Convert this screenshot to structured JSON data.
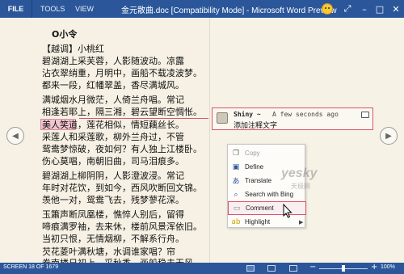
{
  "titlebar": {
    "file_tab": "FILE",
    "tabs": [
      "TOOLS",
      "VIEW"
    ],
    "window_title": "金元散曲.doc [Compatibility Mode] - Microsoft Word Preview"
  },
  "document": {
    "title": "O小令",
    "lines": [
      "【越调】小桃红",
      "碧湖湖上采芙蓉，人影随波动。凉露",
      "沾衣翠绡重，月明中，画船不载凌波梦。",
      "都来一段，红幡翠盖，香尽满城风。",
      "满城烟水月微茫，人倚兰舟唱。常记",
      "相逢若耶上，隔三湘，碧云望断空惆怅。",
      "美人笑道，莲花相似，情短藕丝长。",
      "采莲人和采莲歌，柳外兰舟过，不管",
      "鸳鸯梦惊破，夜如何？有人独上江楼卧。",
      "伤心莫唱，南朝旧曲，司马泪痕多。",
      "碧湖湖上柳阴阴，人影澄波浸。常记",
      "年时对花饮，到如今，西风吹断回文锦。",
      "羡他一对，鸳鸯飞去，残梦蓼花深。",
      "玉簫声断凤凰楼，憔悴人别后，留得",
      "啼痕满罗袖，去来休，楼前风景浑依旧。",
      "当初只恨，无情烟柳，不解系行舟。",
      "芡花菱叶满秋塘，水调谁家唱？帘",
      "卷南楼日初上，采秋香，画船稳去无风"
    ],
    "highlighted_text": "美人笑道"
  },
  "comment": {
    "author": "Shiny ~",
    "time": "A few seconds ago",
    "text": "添加注释文字"
  },
  "context_menu": {
    "items": [
      {
        "label": "Copy",
        "icon": "copy-icon"
      },
      {
        "label": "Define",
        "icon": "define-icon"
      },
      {
        "label": "Translate",
        "icon": "translate-icon"
      },
      {
        "label": "Search with Bing",
        "icon": "search-icon"
      },
      {
        "label": "Comment",
        "icon": "comment-icon"
      },
      {
        "label": "Highlight",
        "icon": "highlight-icon"
      }
    ]
  },
  "watermark": {
    "main": "yesky",
    "sub": "天极网"
  },
  "statusbar": {
    "screen": "SCREEN 18 OF 1679",
    "zoom": "100%"
  },
  "colors": {
    "ribbon": "#2b579a",
    "page": "#f6f1e4",
    "comment_accent": "#d9536b",
    "highlight": "#f1c5cf"
  }
}
